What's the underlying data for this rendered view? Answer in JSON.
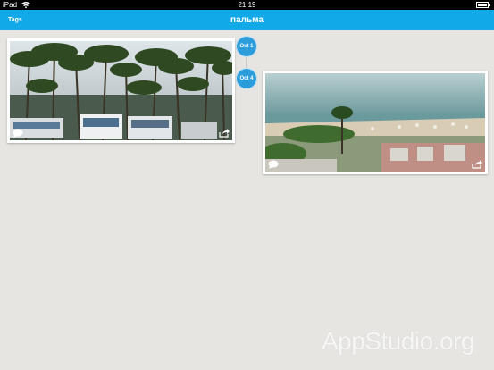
{
  "status_bar": {
    "carrier": "iPad",
    "time": "21:19"
  },
  "nav": {
    "left_button": "Tags",
    "title": "пальма"
  },
  "timeline": [
    {
      "date": "Oct 1",
      "photo_description_icon": "palm-street-photo"
    },
    {
      "date": "Oct 4",
      "photo_description_icon": "beach-photo"
    }
  ],
  "watermark": "AppStudio.org",
  "colors": {
    "accent": "#12a9e8",
    "bubble": "#2b9ddb",
    "background": "#e6e5e1"
  }
}
